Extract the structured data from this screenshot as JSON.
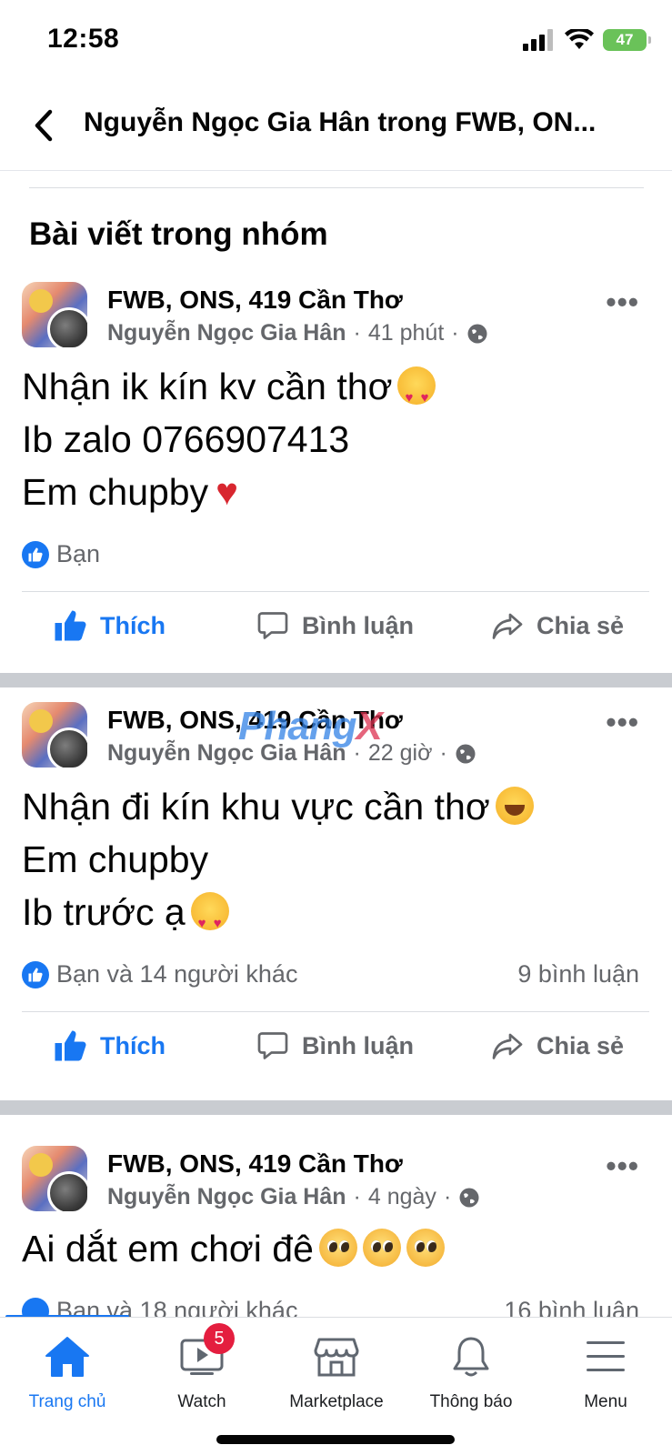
{
  "status_bar": {
    "time": "12:58",
    "battery": "47"
  },
  "header": {
    "title": "Nguyễn Ngọc Gia Hân trong FWB, ON..."
  },
  "section_title": "Bài viết trong nhóm",
  "posts": [
    {
      "group": "FWB, ONS, 419 Cần Thơ",
      "author": "Nguyễn Ngọc Gia Hân",
      "time": "41 phút",
      "lines": [
        "Nhận ik kín kv cần thơ",
        "Ib zalo 0766907413",
        "Em chupby"
      ],
      "reactions": "Bạn",
      "comments": ""
    },
    {
      "group": "FWB, ONS, 419 Cần Thơ",
      "author": "Nguyễn Ngọc Gia Hân",
      "time": "22 giờ",
      "lines": [
        "Nhận đi kín khu vực cần thơ",
        "Em chupby",
        "Ib trước ạ"
      ],
      "reactions": "Bạn và 14 người khác",
      "comments": "9 bình luận"
    },
    {
      "group": "FWB, ONS, 419 Cần Thơ",
      "author": "Nguyễn Ngọc Gia Hân",
      "time": "4 ngày",
      "lines": [
        "Ai dắt em chơi đê"
      ],
      "reactions": "Bạn và 18 người khác",
      "comments": "16 bình luận"
    }
  ],
  "actions": {
    "like": "Thích",
    "comment": "Bình luận",
    "share": "Chia sẻ"
  },
  "meta_separator": "·",
  "watermark": {
    "part1": "Phang",
    "part2": "X"
  },
  "tabs": [
    {
      "label": "Trang chủ",
      "icon": "home-icon",
      "active": true
    },
    {
      "label": "Watch",
      "icon": "watch-icon",
      "badge": "5"
    },
    {
      "label": "Marketplace",
      "icon": "marketplace-icon"
    },
    {
      "label": "Thông báo",
      "icon": "bell-icon"
    },
    {
      "label": "Menu",
      "icon": "menu-icon"
    }
  ],
  "colors": {
    "accent": "#1877f2",
    "badge": "#e41e3f",
    "separator": "#c9ccd1",
    "battery": "#6ac259"
  }
}
